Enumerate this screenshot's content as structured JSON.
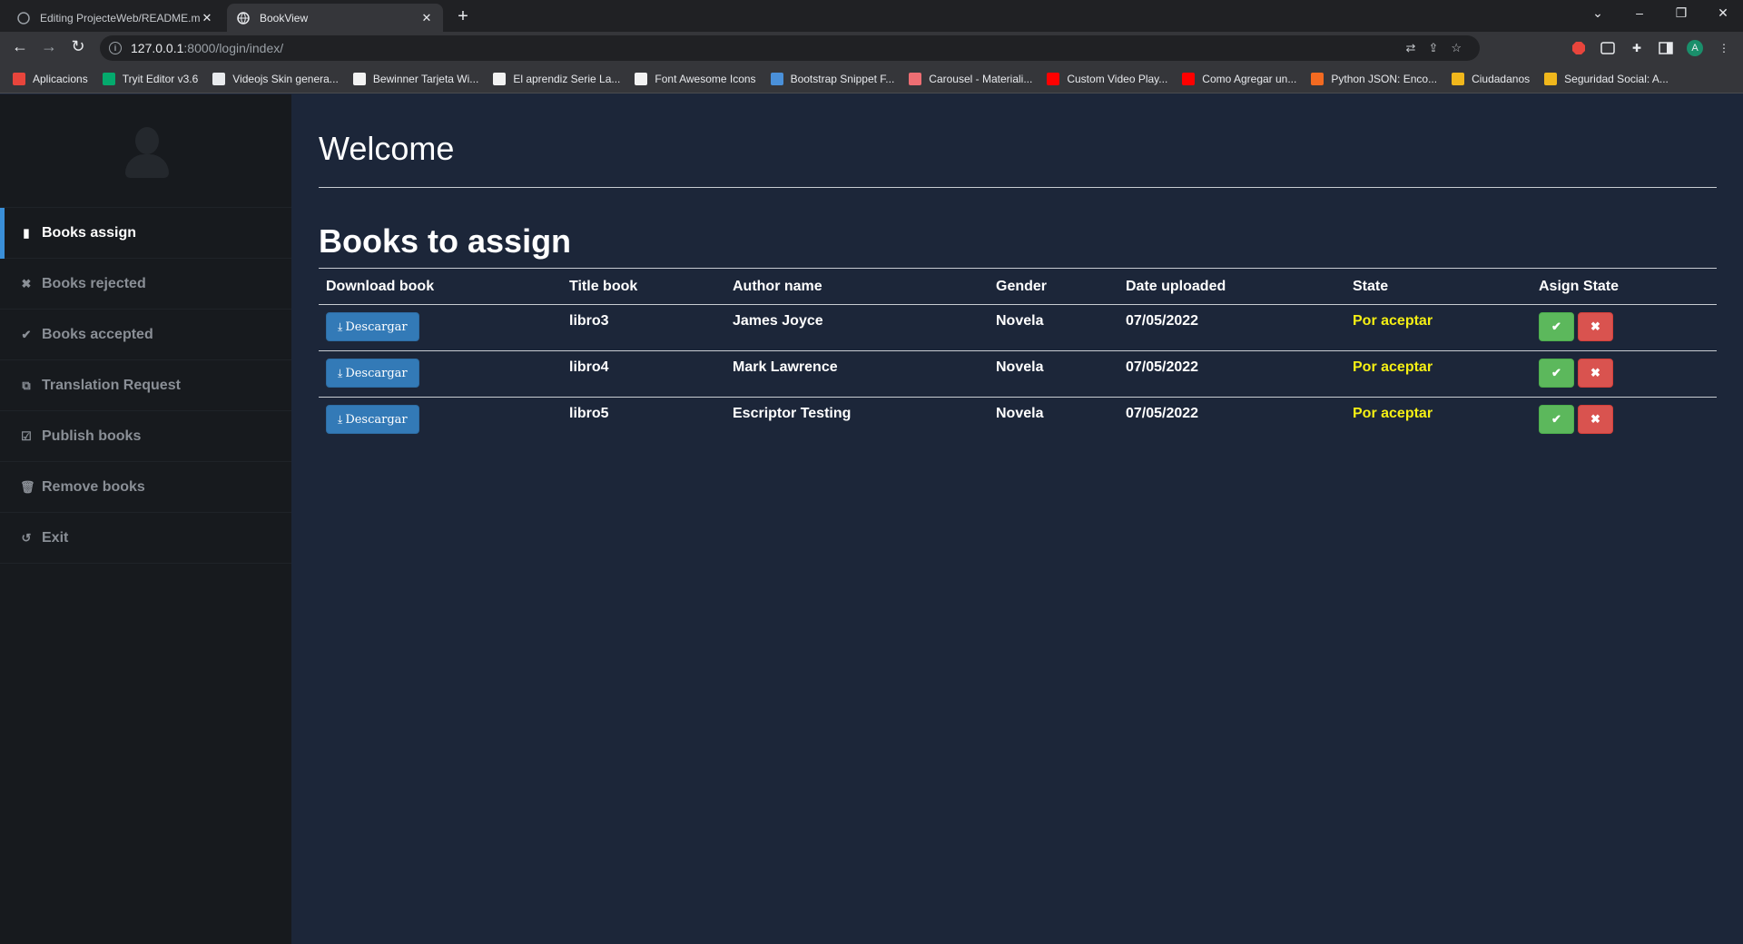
{
  "browser": {
    "tabs": [
      {
        "title": "Editing ProjecteWeb/README.m",
        "active": false
      },
      {
        "title": "BookView",
        "active": true
      }
    ],
    "url_host": "127.0.0.1",
    "url_path": ":8000/login/index/",
    "profile_initial": "A",
    "bookmarks": [
      {
        "label": "Aplicacions",
        "color": "#e8453c"
      },
      {
        "label": "Tryit Editor v3.6",
        "color": "#04aa6d"
      },
      {
        "label": "Videojs Skin genera...",
        "color": "#e8eaed"
      },
      {
        "label": "Bewinner Tarjeta Wi...",
        "color": "#f2f2f2"
      },
      {
        "label": "El aprendiz Serie La...",
        "color": "#f2f2f2"
      },
      {
        "label": "Font Awesome Icons",
        "color": "#f2f2f2"
      },
      {
        "label": "Bootstrap Snippet F...",
        "color": "#4a90d9"
      },
      {
        "label": "Carousel - Materiali...",
        "color": "#ee6e73"
      },
      {
        "label": "Custom Video Play...",
        "color": "#ff0000"
      },
      {
        "label": "Como Agregar un...",
        "color": "#ff0000"
      },
      {
        "label": "Python JSON: Enco...",
        "color": "#f26a21"
      },
      {
        "label": "Ciudadanos",
        "color": "#f0b71c"
      },
      {
        "label": "Seguridad Social: A...",
        "color": "#f0b71c"
      }
    ]
  },
  "sidebar": {
    "items": [
      {
        "label": "Books assign",
        "icon": "book-icon",
        "glyph": "▮",
        "active": true
      },
      {
        "label": "Books rejected",
        "icon": "times-icon",
        "glyph": "✖",
        "active": false
      },
      {
        "label": "Books accepted",
        "icon": "check-icon",
        "glyph": "✔",
        "active": false
      },
      {
        "label": "Translation Request",
        "icon": "copy-icon",
        "glyph": "⧉",
        "active": false
      },
      {
        "label": "Publish books",
        "icon": "check-square-icon",
        "glyph": "☑",
        "active": false
      },
      {
        "label": "Remove books",
        "icon": "trash-icon",
        "glyph": "🗑",
        "active": false
      },
      {
        "label": "Exit",
        "icon": "undo-icon",
        "glyph": "↺",
        "active": false
      }
    ]
  },
  "main": {
    "welcome": "Welcome",
    "section_title": "Books to assign",
    "columns": [
      "Download book",
      "Title book",
      "Author name",
      "Gender",
      "Date uploaded",
      "State",
      "Asign State"
    ],
    "download_label": "Descargar",
    "rows": [
      {
        "title": "libro3",
        "author": "James Joyce",
        "gender": "Novela",
        "date": "07/05/2022",
        "state": "Por aceptar"
      },
      {
        "title": "libro4",
        "author": "Mark Lawrence",
        "gender": "Novela",
        "date": "07/05/2022",
        "state": "Por aceptar"
      },
      {
        "title": "libro5",
        "author": "Escriptor Testing",
        "gender": "Novela",
        "date": "07/05/2022",
        "state": "Por aceptar"
      }
    ]
  }
}
